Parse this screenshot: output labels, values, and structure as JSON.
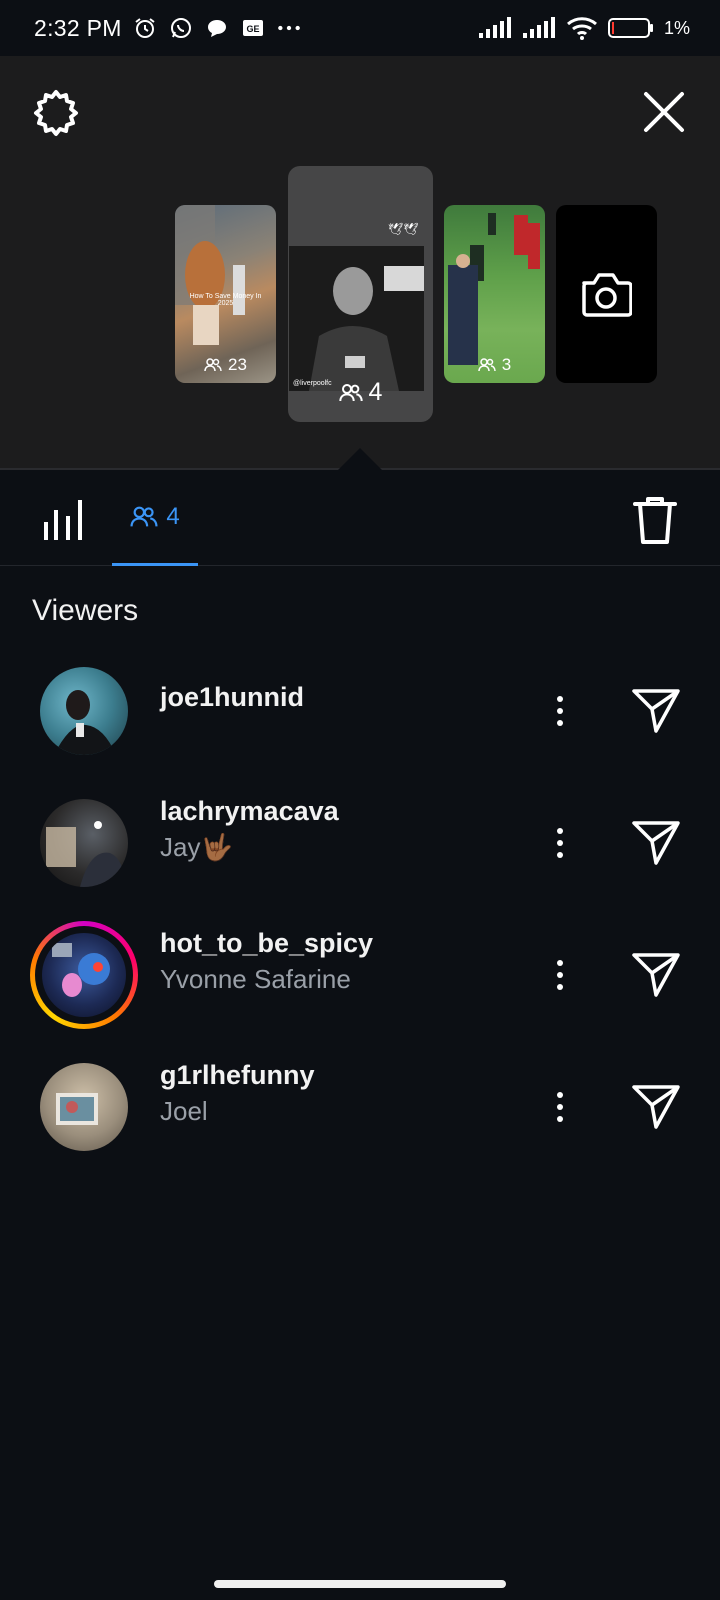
{
  "status_bar": {
    "time": "2:32 PM",
    "battery_percent": "1%",
    "icons": [
      "alarm-icon",
      "whatsapp-icon",
      "chat-bubble-icon",
      "news-icon",
      "more-dots-icon",
      "signal-icon",
      "signal-icon",
      "wifi-icon",
      "battery-icon"
    ]
  },
  "header": {
    "settings_icon": "gear-icon",
    "close_icon": "close-icon"
  },
  "stories": [
    {
      "viewer_count": "23",
      "caption": "How To Save Money In 2025"
    },
    {
      "viewer_count": "4",
      "selected": true,
      "watermark": "@liverpoolfc"
    },
    {
      "viewer_count": "3"
    },
    {
      "type": "add-story",
      "icon": "camera-icon"
    }
  ],
  "tabs": {
    "insights_icon": "bar-chart-icon",
    "viewers_count": "4",
    "delete_icon": "trash-icon"
  },
  "section_title": "Viewers",
  "viewers": [
    {
      "username": "joe1hunnid",
      "subname": "",
      "has_story_ring": false
    },
    {
      "username": "lachrymacava",
      "subname": "Jay🤟🏾",
      "has_story_ring": false
    },
    {
      "username": "hot_to_be_spicy",
      "subname": "Yvonne Safarine",
      "has_story_ring": true
    },
    {
      "username": "g1rlhefunny",
      "subname": "Joel",
      "has_story_ring": false
    }
  ],
  "colors": {
    "accent_blue": "#3b95f6",
    "background": "#0c0f14",
    "panel": "#1c1c1d"
  }
}
